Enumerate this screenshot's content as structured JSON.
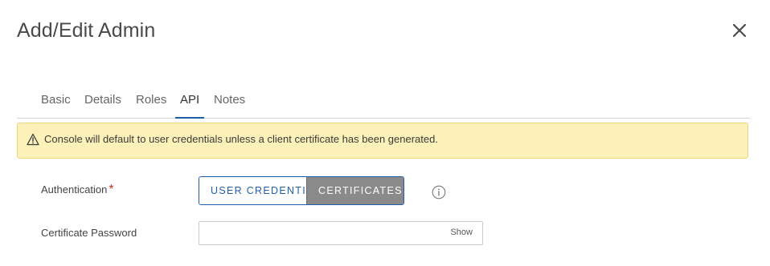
{
  "dialog": {
    "title": "Add/Edit Admin",
    "close_icon": "close-icon"
  },
  "tabs": [
    {
      "label": "Basic",
      "active": false
    },
    {
      "label": "Details",
      "active": false
    },
    {
      "label": "Roles",
      "active": false
    },
    {
      "label": "API",
      "active": true
    },
    {
      "label": "Notes",
      "active": false
    }
  ],
  "warning": {
    "icon": "warning-triangle-icon",
    "text": "Console will default to user credentials unless a client certificate has been generated."
  },
  "authentication": {
    "label": "Authentication",
    "required_mark": "*",
    "options": [
      {
        "label": "USER CREDENTIALS",
        "selected": false
      },
      {
        "label": "CERTIFICATES",
        "selected": true
      }
    ],
    "info_icon": "info-icon"
  },
  "certificate_password": {
    "label": "Certificate Password",
    "value": "",
    "placeholder": "",
    "show_label": "Show"
  },
  "colors": {
    "accent": "#1f5fa9",
    "warning_bg": "#fcf1b9",
    "selected_segment": "#8a8a8a",
    "required": "#c0392b"
  }
}
